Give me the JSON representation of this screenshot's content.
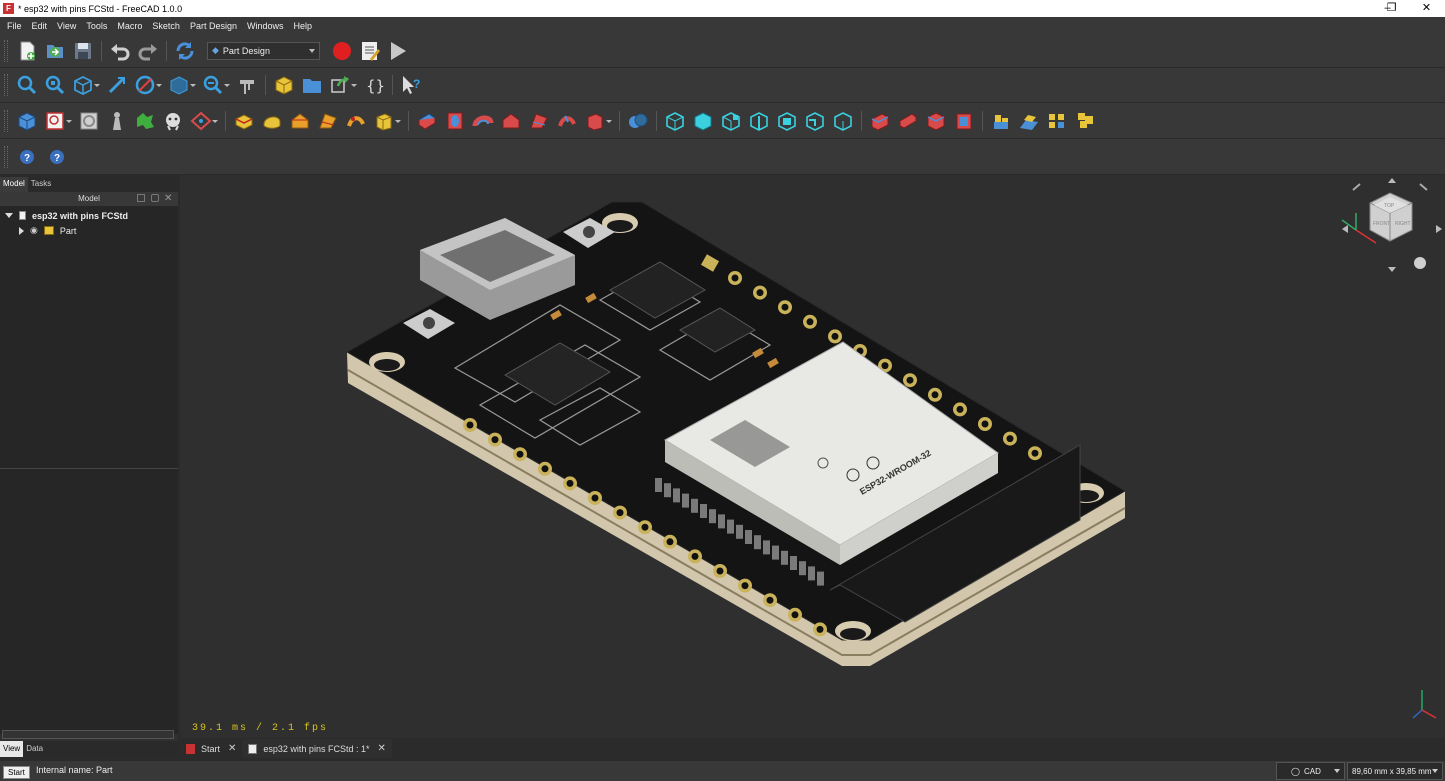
{
  "window": {
    "title": "* esp32 with pins FCStd - FreeCAD 1.0.0",
    "app_icon": "freecad-icon"
  },
  "menu": [
    "File",
    "Edit",
    "View",
    "Tools",
    "Macro",
    "Sketch",
    "Part Design",
    "Windows",
    "Help"
  ],
  "toolbar": {
    "workbench": "Part Design"
  },
  "panel": {
    "tabs": [
      "Model",
      "Tasks"
    ],
    "header": "Model",
    "tree": [
      {
        "label": "esp32 with pins FCStd",
        "expanded": true
      },
      {
        "label": "Part",
        "expanded": false
      }
    ],
    "bottom_tabs": [
      "View",
      "Data"
    ]
  },
  "viewport": {
    "fps": "39.1 ms / 2.1 fps",
    "module_text": "ESP32-WROOM-32",
    "navcube_faces": [
      "TOP",
      "FRONT",
      "RIGHT"
    ]
  },
  "doc_tabs": [
    {
      "label": "Start"
    },
    {
      "label": "esp32 with pins FCStd : 1*"
    }
  ],
  "status": {
    "start_button": "Start",
    "text": "Internal name: Part",
    "nav_style": "CAD",
    "dimensions": "89,60 mm x 39,85 mm"
  },
  "colors": {
    "accent_fps": "#d9c31f",
    "pcb": "#141414",
    "pad": "#c9b25a"
  }
}
